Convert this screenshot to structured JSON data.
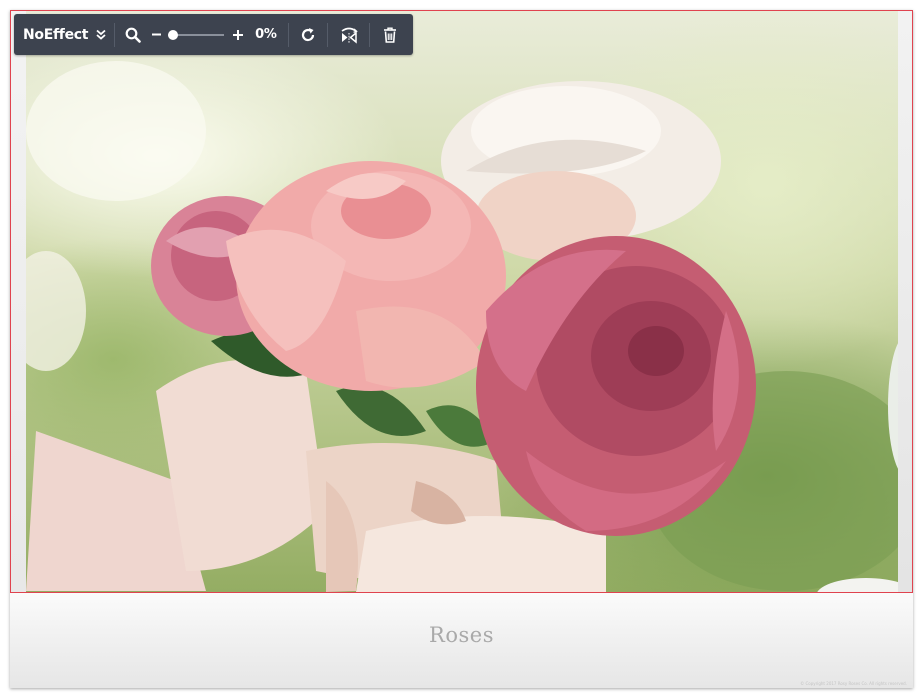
{
  "toolbar": {
    "effect_label": "NoEffect",
    "zoom_value": "0%",
    "zoom_level": 0,
    "icons": {
      "effect_dropdown": "double-chevron-down-icon",
      "zoom": "magnifier-icon",
      "zoom_out": "minus-icon",
      "zoom_in": "plus-icon",
      "reset": "rotate-refresh-icon",
      "flip": "flip-horizontal-icon",
      "delete": "trash-icon"
    },
    "background_color": "#3d434f"
  },
  "image": {
    "border_color": "#e0434f",
    "subject": "bouquet of pink and white roses"
  },
  "caption": {
    "title": "Roses",
    "copyright": "© Copyright 2017 Rosy Roses Co. All rights reserved."
  }
}
